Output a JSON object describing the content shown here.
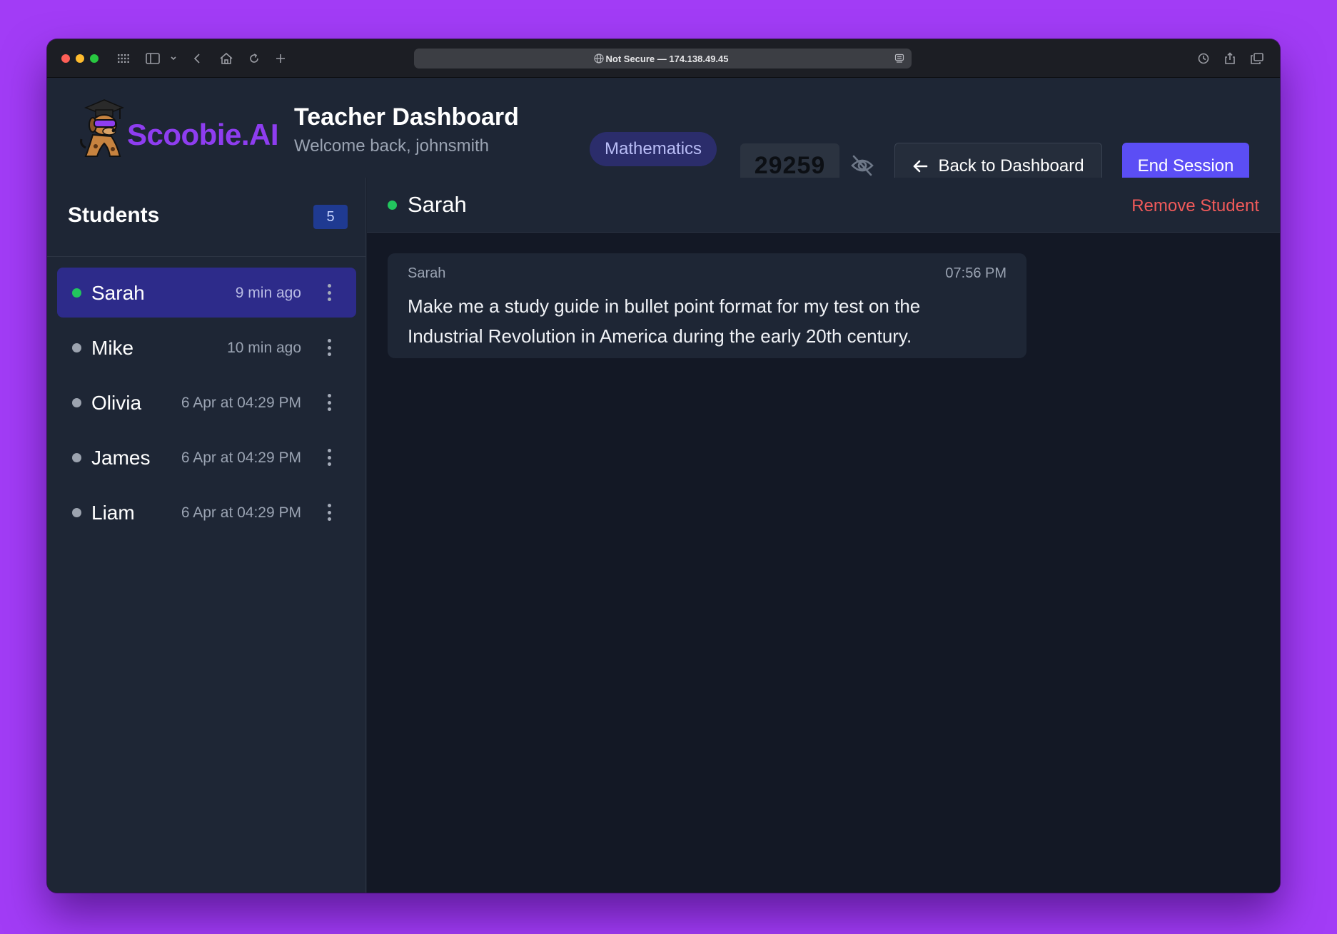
{
  "browser": {
    "url_text": "Not Secure — 174.138.49.45"
  },
  "header": {
    "logo_text": "Scoobie.AI",
    "title": "Teacher Dashboard",
    "subtitle": "Welcome back, johnsmith",
    "subject": "Mathematics",
    "session_code": "29259",
    "back_label": "Back to Dashboard",
    "end_label": "End Session"
  },
  "sidebar": {
    "title": "Students",
    "count": "5",
    "students": [
      {
        "name": "Sarah",
        "time": "9 min ago",
        "online": true,
        "active": true
      },
      {
        "name": "Mike",
        "time": "10 min ago",
        "online": false,
        "active": false
      },
      {
        "name": "Olivia",
        "time": "6 Apr at 04:29 PM",
        "online": false,
        "active": false
      },
      {
        "name": "James",
        "time": "6 Apr at 04:29 PM",
        "online": false,
        "active": false
      },
      {
        "name": "Liam",
        "time": "6 Apr at 04:29 PM",
        "online": false,
        "active": false
      }
    ]
  },
  "chat": {
    "student_name": "Sarah",
    "remove_label": "Remove Student",
    "messages": [
      {
        "sender": "Sarah",
        "time": "07:56 PM",
        "text": "Make me a study guide in bullet point format for my test on the Industrial Revolution in America during the early 20th century."
      }
    ]
  },
  "colors": {
    "online": "#22c55e",
    "offline": "#9ca3af",
    "accent": "#5b4ef5",
    "brand": "#8e3df0",
    "danger": "#f15a5a"
  },
  "icons": {
    "eye_toggle": "eye-slash-icon",
    "back": "arrow-left-icon",
    "row_menu": "kebab-menu-icon"
  }
}
